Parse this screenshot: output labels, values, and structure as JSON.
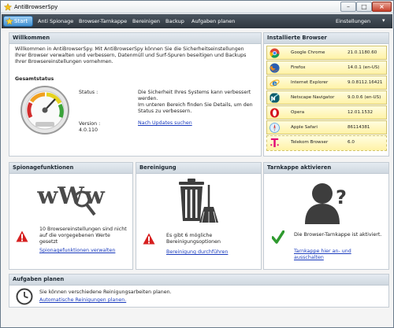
{
  "window": {
    "title": "AntiBrowserSpy"
  },
  "nav": {
    "start": "Start",
    "items": [
      "Anti Spionage",
      "Browser-Tarnkappe",
      "Bereinigen",
      "Backup",
      "Aufgaben planen"
    ],
    "settings": "Einstellungen"
  },
  "welcome": {
    "title": "Willkommen",
    "intro": "Willkommen in AntiBrowserSpy. Mit AntiBrowserSpy können Sie die Sicherheitseinstellungen Ihrer Browser verwalten und verbessern, Datenmüll und Surf-Spuren beseitigen und Backups Ihrer Browsereinstellungen vornehmen.",
    "overall_label": "Gesamtstatus",
    "status_label": "Status :",
    "status_text": "Die Sicherheit Ihres Systems kann verbessert werden.",
    "status_hint": "Im unteren Bereich finden Sie Details, um den Status zu verbessern.",
    "version_label": "Version :",
    "version_value": "4.0.110",
    "update_link": "Nach Updates suchen"
  },
  "browsers": {
    "title": "Installierte Browser",
    "items": [
      {
        "name": "Google Chrome",
        "version": "21.0.1180.60",
        "icon": "chrome-icon"
      },
      {
        "name": "Firefox",
        "version": "14.0.1 (en-US)",
        "icon": "firefox-icon"
      },
      {
        "name": "Internet Explorer",
        "version": "9.0.8112.16421",
        "icon": "ie-icon"
      },
      {
        "name": "Netscape Navigator",
        "version": "9.0.0.6 (en-US)",
        "icon": "netscape-icon"
      },
      {
        "name": "Opera",
        "version": "12.01.1532",
        "icon": "opera-icon"
      },
      {
        "name": "Apple Safari",
        "version": "86114381",
        "icon": "safari-icon"
      },
      {
        "name": "Telekom Browser",
        "version": "6.0",
        "icon": "telekom-icon"
      }
    ]
  },
  "spy": {
    "title": "Spionagefunktionen",
    "text": "10 Browsereinstellungen sind nicht auf die vorgegebenen Werte gesetzt",
    "link": "Spionagefunktionen verwalten"
  },
  "clean": {
    "title": "Bereinigung",
    "text": "Es gibt 6 mögliche Bereinigungsoptionen",
    "link": "Bereinigung durchführen"
  },
  "stealth": {
    "title": "Tarnkappe aktivieren",
    "text": "Die Browser-Tarnkappe ist aktiviert.",
    "link": "Tarnkappe hier an- und ausschalten"
  },
  "tasks": {
    "title": "Aufgaben planen",
    "text": "Sie können verschiedene Reinigungsarbeiten planen.",
    "link": "Automatische Reinigungen planen."
  }
}
